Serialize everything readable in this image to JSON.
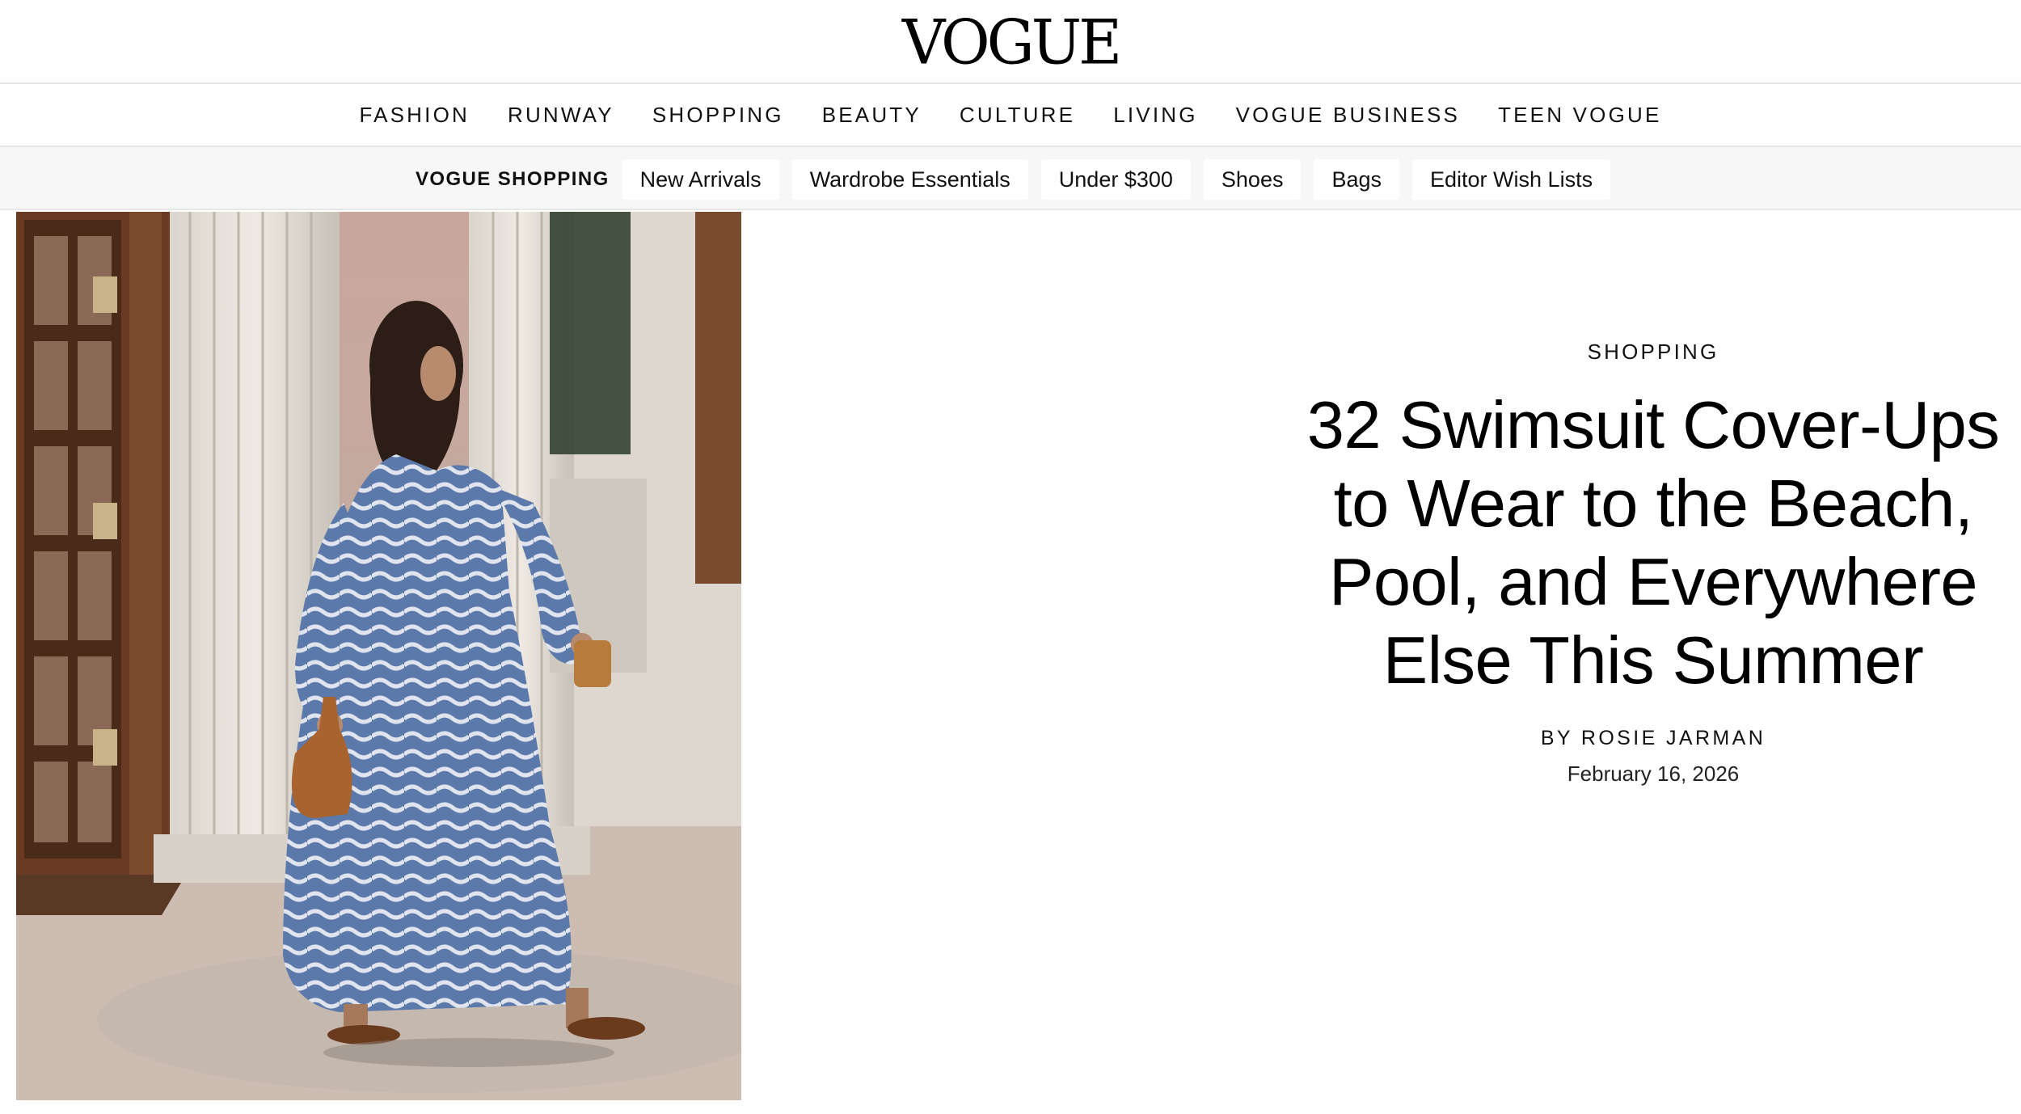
{
  "site": {
    "logo": "VOGUE"
  },
  "main_nav": {
    "items": [
      {
        "label": "FASHION"
      },
      {
        "label": "RUNWAY"
      },
      {
        "label": "SHOPPING"
      },
      {
        "label": "BEAUTY"
      },
      {
        "label": "CULTURE"
      },
      {
        "label": "LIVING"
      },
      {
        "label": "VOGUE BUSINESS"
      },
      {
        "label": "TEEN VOGUE"
      }
    ]
  },
  "sub_nav": {
    "section_label": "VOGUE SHOPPING",
    "chips": [
      {
        "label": "New Arrivals"
      },
      {
        "label": "Wardrobe Essentials"
      },
      {
        "label": "Under $300"
      },
      {
        "label": "Shoes"
      },
      {
        "label": "Bags"
      },
      {
        "label": "Editor Wish Lists"
      }
    ]
  },
  "article": {
    "rubric": "SHOPPING",
    "headline": "32 Swimsuit Cover-Ups to Wear to the Beach, Pool, and Everywhere Else This Summer",
    "byline_prefix": "BY ",
    "author": "ROSIE JARMAN",
    "date": "February 16, 2026"
  },
  "hero_image": {
    "subject": "woman-walking-in-wave-print-maxi-dress-icon"
  },
  "colors": {
    "background": "#ffffff",
    "text": "#000000",
    "divider": "#e6e6e6",
    "subnav_bg": "#f7f7f7"
  }
}
